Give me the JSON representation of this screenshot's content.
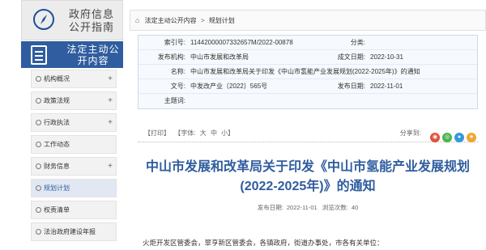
{
  "sidebar": {
    "guide_title": "政府信息公开指南",
    "public_title": "法定主动公开内容",
    "items": [
      {
        "label": "机构概况",
        "active": false
      },
      {
        "label": "政策法规",
        "active": false
      },
      {
        "label": "行政执法",
        "active": false
      },
      {
        "label": "工作动态",
        "active": false
      },
      {
        "label": "财务信息",
        "active": false
      },
      {
        "label": "规划计划",
        "active": true
      },
      {
        "label": "权责清单",
        "active": false
      },
      {
        "label": "法治政府建设年报",
        "active": false
      }
    ]
  },
  "breadcrumb": {
    "home": "法定主动公开内容",
    "separator": ">",
    "current": "规划计划"
  },
  "meta": {
    "index_label": "索引号:",
    "index_value": "11442000007332657M/2022-00878",
    "category_label": "分类:",
    "category_value": "",
    "publisher_label": "发布机构:",
    "publisher_value": "中山市发展和改革局",
    "created_label": "成文日期:",
    "created_value": "2022-10-31",
    "name_label": "名称:",
    "name_value": "中山市发展和改革局关于印发《中山市氢能产业发展规划(2022-2025年)》的通知",
    "docno_label": "文号:",
    "docno_value": "中发改产业〔2022〕565号",
    "pubdate_label": "发布日期:",
    "pubdate_value": "2022-11-01",
    "subject_label": "主题词:",
    "subject_value": ""
  },
  "toolbar": {
    "print": "【打印】",
    "font_label": "【字体:",
    "font_large": "大",
    "font_medium": "中",
    "font_small": "小】",
    "share_label": "分享到:"
  },
  "colors": {
    "accent": "#2f5d9f",
    "share_icons": [
      "#e2513b",
      "#4bb34b",
      "#3399dd",
      "#f0a630"
    ]
  },
  "article": {
    "title": "中山市发展和改革局关于印发《中山市氢能产业发展规划(2022-2025年)》的通知",
    "date_label": "发布日期:",
    "date_value": "2022-11-01",
    "views_label": "浏览次数:",
    "views_value": "40",
    "body_first_line": "火炬开发区管委会，翠亨新区管委会，各镇政府，街道办事处，市各有关单位："
  }
}
